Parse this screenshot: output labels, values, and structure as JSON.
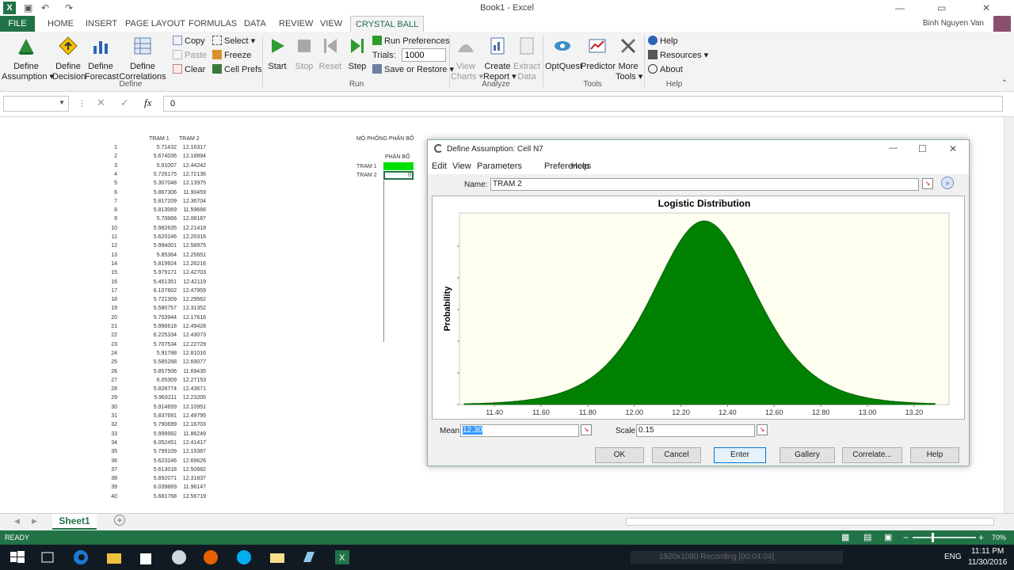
{
  "app": {
    "title": "Book1 - Excel",
    "user": "Binh Nguyen Van"
  },
  "tabs": [
    "FILE",
    "HOME",
    "INSERT",
    "PAGE LAYOUT",
    "FORMULAS",
    "DATA",
    "REVIEW",
    "VIEW",
    "CRYSTAL BALL"
  ],
  "ribbon": {
    "define": {
      "define_assumption": "Define\nAssumption ▾",
      "define_decision": "Define\nDecision",
      "define_forecast": "Define\nForecast",
      "define_correlations": "Define\nCorrelations",
      "copy": "Copy",
      "paste": "Paste",
      "clear": "Clear",
      "select": "Select ▾",
      "freeze": "Freeze",
      "cell_prefs": "Cell Prefs",
      "label": "Define"
    },
    "run": {
      "start": "Start",
      "stop": "Stop",
      "reset": "Reset",
      "step": "Step",
      "run_prefs": "Run Preferences",
      "trials_label": "Trials:",
      "trials_value": "1000",
      "save_restore": "Save or Restore ▾",
      "label": "Run"
    },
    "analyze": {
      "view_charts": "View\nCharts ▾",
      "create_report": "Create\nReport ▾",
      "extract_data": "Extract\nData",
      "label": "Analyze"
    },
    "tools": {
      "optquest": "OptQuest",
      "predictor": "Predictor",
      "more_tools": "More\nTools ▾",
      "label": "Tools"
    },
    "help": {
      "help": "Help",
      "resources": "Resources ▾",
      "about": "About",
      "label": "Help"
    }
  },
  "formula_bar": {
    "value": "0",
    "fx": "fx"
  },
  "sheet": {
    "headers": [
      "TRAM 1",
      "TRAM 2"
    ],
    "rows": [
      [
        1,
        "5.71432",
        "12.16317"
      ],
      [
        2,
        "5.674036",
        "12.18894"
      ],
      [
        3,
        "5.91007",
        "12.44242"
      ],
      [
        4,
        "5.726175",
        "12.72136"
      ],
      [
        5,
        "5.307048",
        "12.13975"
      ],
      [
        6,
        "5.867306",
        "11.90459"
      ],
      [
        7,
        "5.817209",
        "12.36704"
      ],
      [
        8,
        "5.813069",
        "11.59666"
      ],
      [
        9,
        "5.70866",
        "12.08187"
      ],
      [
        10,
        "5.982635",
        "12.21418"
      ],
      [
        11,
        "5.620246",
        "12.20316"
      ],
      [
        12,
        "5.994001",
        "12.58975"
      ],
      [
        13,
        "5.85364",
        "12.25651"
      ],
      [
        14,
        "5.819924",
        "12.26216"
      ],
      [
        15,
        "5.979171",
        "12.42703"
      ],
      [
        16,
        "5.451351",
        "12.42119"
      ],
      [
        17,
        "6.107602",
        "12.47959"
      ],
      [
        18,
        "5.721309",
        "12.29562"
      ],
      [
        19,
        "5.580757",
        "12.31352"
      ],
      [
        20,
        "5.703944",
        "12.17616"
      ],
      [
        21,
        "5.996618",
        "12.49428"
      ],
      [
        22,
        "6.225334",
        "12.43073"
      ],
      [
        23,
        "5.707534",
        "12.22729"
      ],
      [
        24,
        "5.91788",
        "12.81016"
      ],
      [
        25,
        "5.585288",
        "12.69077"
      ],
      [
        26,
        "5.857506",
        "11.69435"
      ],
      [
        27,
        "6.05309",
        "12.27153"
      ],
      [
        28,
        "5.828774",
        "12.43671"
      ],
      [
        29,
        "5.963211",
        "12.23205"
      ],
      [
        30,
        "5.914659",
        "12.10951"
      ],
      [
        31,
        "5.837691",
        "12.49795"
      ],
      [
        32,
        "5.790699",
        "12.16703"
      ],
      [
        33,
        "5.999992",
        "11.86249"
      ],
      [
        34,
        "6.052451",
        "12.41417"
      ],
      [
        35,
        "5.799109",
        "12.15387"
      ],
      [
        36,
        "5.623246",
        "12.69626"
      ],
      [
        37,
        "5.613018",
        "12.50682"
      ],
      [
        38,
        "5.892071",
        "12.31837"
      ],
      [
        39,
        "6.039869",
        "11.96147"
      ],
      [
        40,
        "5.681768",
        "12.56719"
      ]
    ],
    "sim_title": "MÔ PHỎNG PHÂN BỐ",
    "sim_header": "PHÂN BỐ",
    "sim_labels": [
      "TRAM 1",
      "TRAM 2"
    ],
    "sim_value": "0"
  },
  "sheet_tab": "Sheet1",
  "status": {
    "ready": "READY",
    "zoom": "70%"
  },
  "dialog": {
    "title": "Define Assumption: Cell N7",
    "menu": [
      "Edit",
      "View",
      "Parameters",
      "Preferences",
      "Help"
    ],
    "name_label": "Name:",
    "name_value": "TRAM 2",
    "mean_label": "Mean",
    "mean_value": "12.30",
    "scale_label": "Scale",
    "scale_value": "0.15",
    "buttons": [
      "OK",
      "Cancel",
      "Enter",
      "Gallery",
      "Correlate...",
      "Help"
    ]
  },
  "chart_data": {
    "type": "area",
    "title": "Logistic Distribution",
    "xlabel": "",
    "ylabel": "Probability",
    "distribution": "logistic",
    "mean": 12.3,
    "scale": 0.15,
    "x_ticks": [
      "11.40",
      "11.60",
      "11.80",
      "12.00",
      "12.20",
      "12.40",
      "12.60",
      "12.80",
      "13.00",
      "13.20"
    ],
    "xlim": [
      11.25,
      13.35
    ],
    "fill": "#008000",
    "background": "#fffff0"
  },
  "taskbar": {
    "time": "11:11 PM",
    "date": "11/30/2016",
    "lang": "ENG",
    "recording": "1920x1080 Recording [00:04:04]"
  }
}
